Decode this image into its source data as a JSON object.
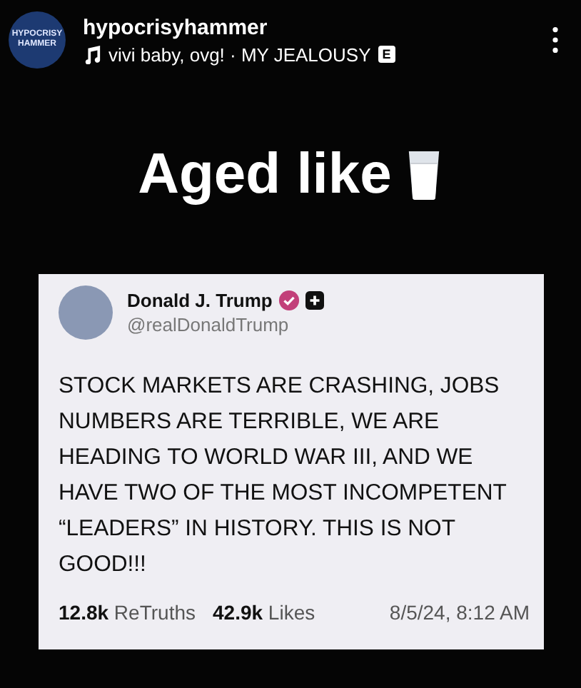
{
  "header": {
    "avatar_text": "HYPOCRISY HAMMER",
    "username": "hypocrisyhammer",
    "audio": "vivi baby, ovg! · MY JEALOUSY",
    "explicit_badge": "E"
  },
  "caption": "Aged like",
  "post": {
    "name": "Donald J. Trump",
    "verified": true,
    "handle": "@realDonaldTrump",
    "text": "STOCK MARKETS ARE CRASHING, JOBS NUMBERS ARE TERRIBLE, WE ARE HEADING TO WORLD WAR III, AND WE HAVE TWO OF THE MOST INCOMPETENT “LEADERS” IN HISTORY. THIS IS NOT GOOD!!!",
    "stats": [
      "**12.8k** ReTruths",
      "**42.9k** Likes"
    ],
    "timestamp": "8/5/24, 8:12 AM"
  }
}
